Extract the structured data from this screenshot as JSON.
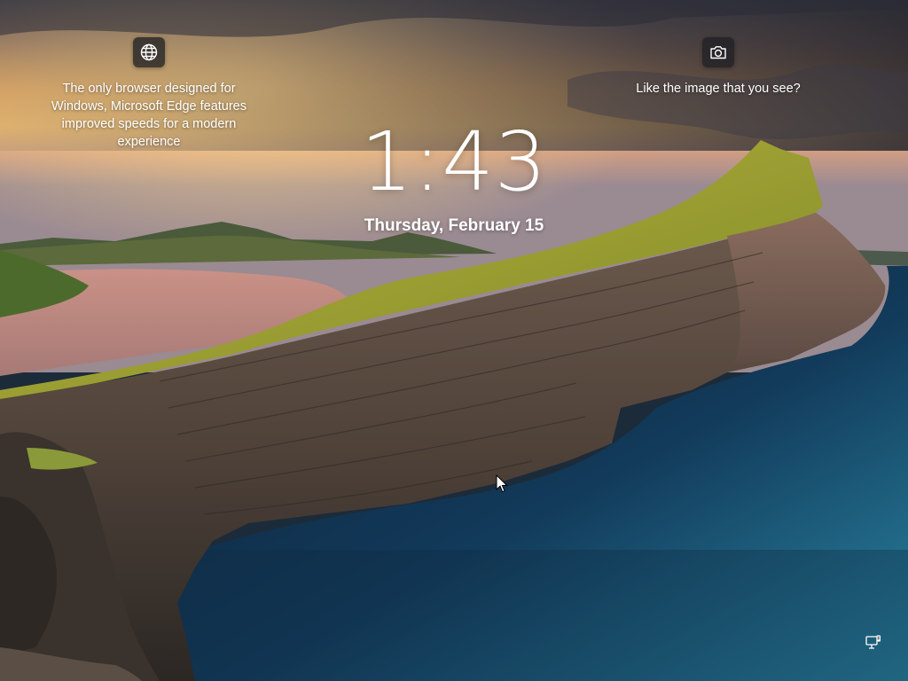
{
  "lock_screen": {
    "time": "1:43",
    "date": "Thursday, February 15",
    "left_widget": {
      "icon": "globe-icon",
      "text": "The only browser designed for Windows, Microsoft Edge features improved speeds for a modern experience"
    },
    "right_widget": {
      "icon": "camera-icon",
      "text": "Like the image that you see?"
    },
    "status": {
      "icon": "network-icon"
    }
  },
  "colors": {
    "text": "#ffffff",
    "icon_button_bg": "#202024",
    "sea": "#123a5a",
    "grass": "#a8a531",
    "cliff": "#5a4a40",
    "sky_sunset": "#e7a45a"
  }
}
